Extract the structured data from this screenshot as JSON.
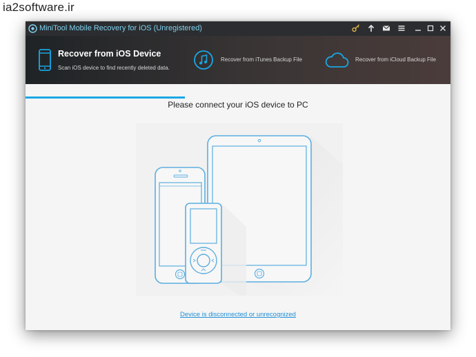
{
  "watermark": "ia2software.ir",
  "window": {
    "title": "MiniTool Mobile Recovery for iOS (Unregistered)",
    "controls": [
      "key-icon",
      "upload-icon",
      "mail-icon",
      "menu-icon",
      "minimize-icon",
      "maximize-icon",
      "close-icon"
    ]
  },
  "modes": {
    "ios_device": {
      "title": "Recover from iOS Device",
      "description": "Scan iOS device to find recently deleted data."
    },
    "itunes": {
      "label": "Recover from iTunes Backup File"
    },
    "icloud": {
      "label": "Recover from iCloud Backup File"
    }
  },
  "main": {
    "prompt": "Please connect your iOS device to PC",
    "status_link": "Device is disconnected or unrecognized"
  },
  "colors": {
    "accent": "#1aa7e4",
    "titlebar_text": "#7fd1ee",
    "illustration_stroke": "#5aaee0",
    "link": "#1f8fd6"
  }
}
